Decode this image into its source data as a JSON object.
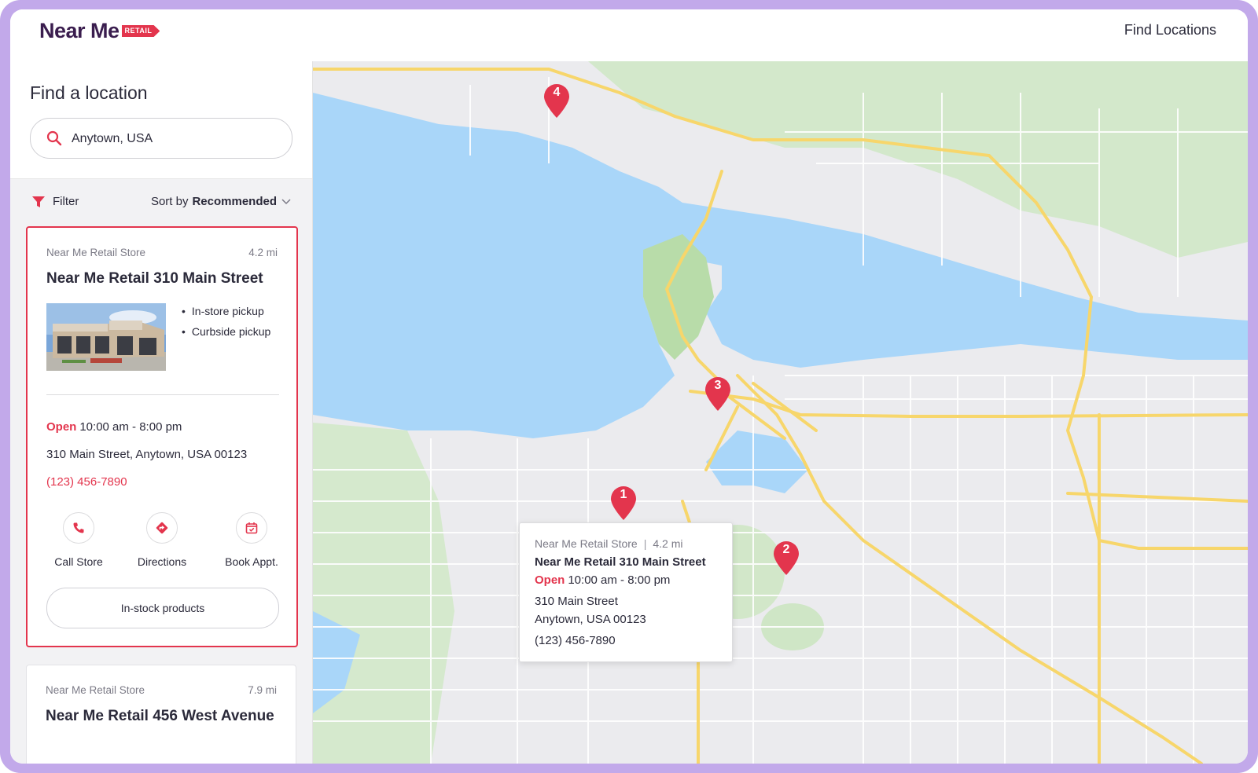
{
  "brand": {
    "name": "Near Me",
    "tag": "RETAIL"
  },
  "nav": {
    "find_locations": "Find Locations"
  },
  "search": {
    "title": "Find a location",
    "value": "Anytown, USA"
  },
  "filter": {
    "label": "Filter",
    "sort_prefix": "Sort by",
    "sort_value": "Recommended"
  },
  "stores": [
    {
      "category": "Near Me Retail Store",
      "distance": "4.2 mi",
      "name": "Near Me Retail 310 Main Street",
      "features": [
        "In-store pickup",
        "Curbside pickup"
      ],
      "status": "Open",
      "hours": "10:00 am - 8:00 pm",
      "address": "310 Main Street, Anytown, USA 00123",
      "phone": "(123) 456-7890",
      "actions": {
        "call": "Call Store",
        "directions": "Directions",
        "book": "Book Appt."
      },
      "stock_button": "In-stock products"
    },
    {
      "category": "Near Me Retail Store",
      "distance": "7.9 mi",
      "name": "Near Me Retail 456 West Avenue"
    }
  ],
  "map": {
    "pins": [
      "1",
      "2",
      "3",
      "4"
    ],
    "popup": {
      "category": "Near Me Retail Store",
      "separator": "|",
      "distance": "4.2 mi",
      "name": "Near Me Retail 310 Main Street",
      "status": "Open",
      "hours": "10:00 am - 8:00 pm",
      "address_line1": "310 Main Street",
      "address_line2": "Anytown, USA 00123",
      "phone": "(123) 456-7890"
    }
  },
  "colors": {
    "accent": "#e3354d",
    "frame": "#c2a9ea",
    "water": "#a9d6f9",
    "park": "#cde6c4",
    "road_major": "#f7d66b",
    "land": "#ebebee"
  }
}
